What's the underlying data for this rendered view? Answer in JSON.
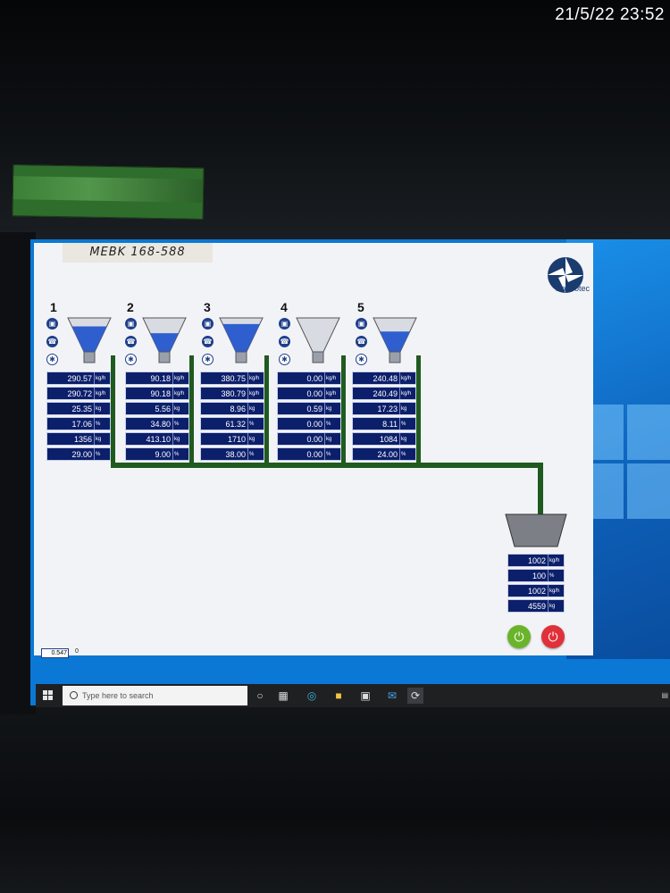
{
  "timestamp": "21/5/22 23:52",
  "label_sticker": "MEBK 168-588",
  "app_logo_text": "AarCotec",
  "stations": [
    {
      "number": "1",
      "rows": [
        {
          "v": "290.57",
          "u": "kg/h"
        },
        {
          "v": "290.72",
          "u": "kg/h"
        },
        {
          "v": "25.35",
          "u": "kg"
        },
        {
          "v": "17.06",
          "u": "%"
        },
        {
          "v": "1356",
          "u": "kg"
        },
        {
          "v": "29.00",
          "u": "%"
        }
      ]
    },
    {
      "number": "2",
      "rows": [
        {
          "v": "90.18",
          "u": "kg/h"
        },
        {
          "v": "90.18",
          "u": "kg/h"
        },
        {
          "v": "5.56",
          "u": "kg"
        },
        {
          "v": "34.80",
          "u": "%"
        },
        {
          "v": "413.10",
          "u": "kg"
        },
        {
          "v": "9.00",
          "u": "%"
        }
      ]
    },
    {
      "number": "3",
      "rows": [
        {
          "v": "380.75",
          "u": "kg/h"
        },
        {
          "v": "380.79",
          "u": "kg/h"
        },
        {
          "v": "8.96",
          "u": "kg"
        },
        {
          "v": "61.32",
          "u": "%"
        },
        {
          "v": "1710",
          "u": "kg"
        },
        {
          "v": "38.00",
          "u": "%"
        }
      ]
    },
    {
      "number": "4",
      "rows": [
        {
          "v": "0.00",
          "u": "kg/h"
        },
        {
          "v": "0.00",
          "u": "kg/h"
        },
        {
          "v": "0.59",
          "u": "kg"
        },
        {
          "v": "0.00",
          "u": "%"
        },
        {
          "v": "0.00",
          "u": "kg"
        },
        {
          "v": "0.00",
          "u": "%"
        }
      ]
    },
    {
      "number": "5",
      "rows": [
        {
          "v": "240.48",
          "u": "kg/h"
        },
        {
          "v": "240.49",
          "u": "kg/h"
        },
        {
          "v": "17.23",
          "u": "kg"
        },
        {
          "v": "8.11",
          "u": "%"
        },
        {
          "v": "1084",
          "u": "kg"
        },
        {
          "v": "24.00",
          "u": "%"
        }
      ]
    }
  ],
  "output": {
    "rows": [
      {
        "v": "1002",
        "u": "kg/h"
      },
      {
        "v": "100",
        "u": "%"
      },
      {
        "v": "1002",
        "u": "kg/h"
      },
      {
        "v": "4559",
        "u": "kg"
      }
    ]
  },
  "status_value": "0.547",
  "status_extra": "0",
  "taskbar": {
    "search_placeholder": "Type here to search"
  },
  "colors": {
    "panel_bg": "#0c1f6b",
    "pipe": "#1f5a1f",
    "start_button": "#6ab42a",
    "stop_button": "#e0303a",
    "accent": "#1e3f8a"
  }
}
